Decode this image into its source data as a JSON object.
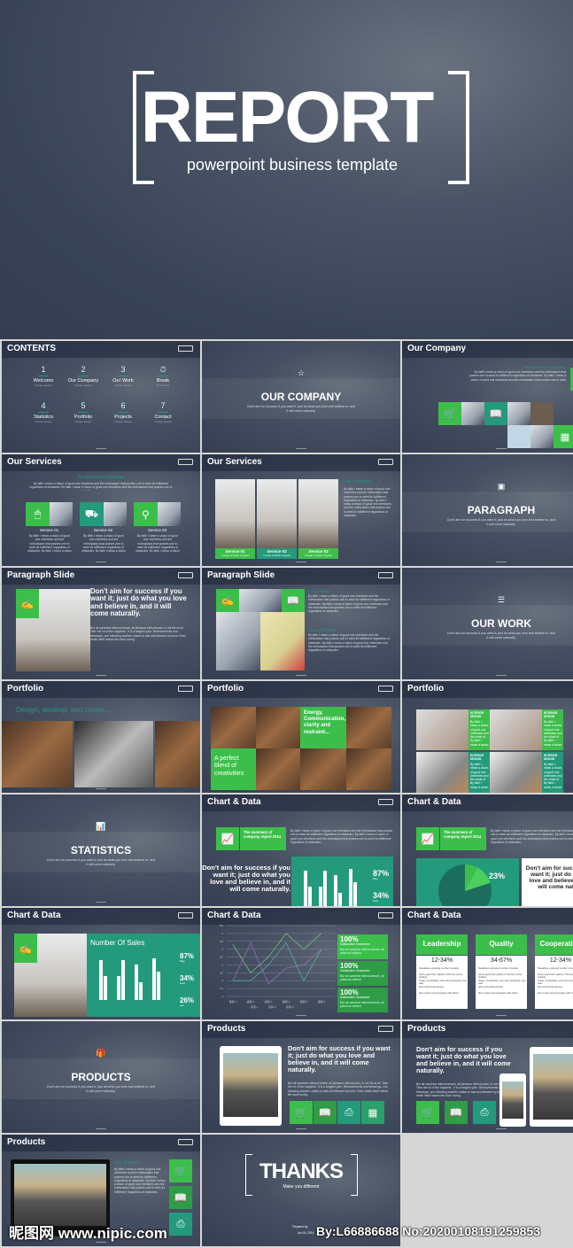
{
  "hero": {
    "title": "REPORT",
    "subtitle": "powerpoint business template"
  },
  "colors": {
    "green": "#3cbf4a",
    "green_dark": "#2e9d45",
    "teal": "#239a7c",
    "bg": "#3a4457"
  },
  "lorem": "By faith I mean a vision of good one cherishes and the enthusiasm that pushes one to seek its fulfillment regardless of obstacles. By faith I mean a vision of good one cherishes and the enthusiasm that pushes one to seek its fulfillment regardless of obstacles.",
  "lorem2": "But all sunshine without shade, all pleasure without pain, is not life at all. Take the lot of the happiest - it is a tangled yarn. Bereavements and blessings, one following another, make us sad and blessed by turns. Even death itself makes life more loving.",
  "slides": [
    {
      "type": "contents",
      "title": "CONTENTS",
      "items": [
        {
          "num": "1",
          "label": "Welcome",
          "sub": "Unique design"
        },
        {
          "num": "2",
          "label": "Our Company",
          "sub": "Unique design"
        },
        {
          "num": "3",
          "label": "Our Work",
          "sub": "Unique design"
        },
        {
          "num": "⏱",
          "label": "Break",
          "sub": "10 minutes"
        },
        {
          "num": "4",
          "label": "Statistics",
          "sub": "Unique design"
        },
        {
          "num": "5",
          "label": "Portfolio",
          "sub": "Unique design"
        },
        {
          "num": "6",
          "label": "Projects",
          "sub": "Unique design"
        },
        {
          "num": "7",
          "label": "Contact",
          "sub": "Unique design"
        }
      ]
    },
    {
      "type": "section",
      "icon": "star-icon",
      "glyph": "☆",
      "heading": "OUR COMPANY",
      "text": "Don't aim for success if you want it; just do what you love and believe in, and it will come naturally."
    },
    {
      "type": "company",
      "title": "Our Company",
      "heading": "An Awesome Company"
    },
    {
      "type": "services",
      "title": "Our Services",
      "heading": "An Awesome Company",
      "services": [
        {
          "label": "Service 01",
          "icon": "mouse-icon",
          "glyph": "🖱"
        },
        {
          "label": "Service 02",
          "icon": "truck-icon",
          "glyph": "⛟"
        },
        {
          "label": "Service 03",
          "icon": "usb-icon",
          "glyph": "⚲"
        }
      ]
    },
    {
      "type": "services2",
      "title": "Our Services",
      "heading": "Our Company",
      "services": [
        {
          "label": "Service 01",
          "sub": "I mean a vision of good"
        },
        {
          "label": "Service 02",
          "sub": "I mean a vision of good"
        },
        {
          "label": "Service 03",
          "sub": "I mean a vision of good"
        }
      ]
    },
    {
      "type": "section",
      "icon": "image-icon",
      "glyph": "▣",
      "heading": "PARAGRAPH",
      "text": "Don't aim for success if you want it; just do what you love and believe in, and it will come naturally."
    },
    {
      "type": "paragraph1",
      "title": "Paragraph Slide",
      "quote": "Don't aim for success if you want it; just do what you love and believe in, and it will come naturally."
    },
    {
      "type": "paragraph2",
      "title": "Paragraph Slide",
      "ch1": "First chapter",
      "ch2": "Second chapter"
    },
    {
      "type": "section",
      "icon": "list-icon",
      "glyph": "☰",
      "heading": "OUR WORK",
      "text": "Don't aim for success if you want it; just do what you love and believe in, and it will come naturally."
    },
    {
      "type": "portfolio1",
      "title": "Portfolio",
      "tagline": "Design, develop, and create...."
    },
    {
      "type": "portfolio2",
      "title": "Portfolio",
      "box1": "Energy, Communication, clarity and restraint...",
      "box2": "A perfect blend of creativities"
    },
    {
      "type": "portfolio3",
      "title": "Portfolio",
      "label": "INTERIOR DESIGN",
      "text": "By faith I mean a vision of good one cherishes and the chain of By faith I mean a vision of"
    },
    {
      "type": "section",
      "icon": "bar-chart-icon",
      "glyph": "📊",
      "heading": "STATISTICS",
      "text": "Don't aim for success if you want it; just do what you love and believe in, and it will come naturally."
    },
    {
      "type": "bar",
      "title": "Chart & Data",
      "summary": "The summary of company report 2014",
      "quote": "Don't aim for success if you want it; just do what you love and believe in, and it will come naturally.",
      "bars": [
        [
          5,
          3
        ],
        [
          3,
          5
        ],
        [
          4.5,
          2.2
        ],
        [
          5.2,
          3.6
        ]
      ],
      "stats": [
        {
          "value": "87%",
          "label": "May"
        },
        {
          "value": "34%",
          "label": "Feel"
        }
      ]
    },
    {
      "type": "pie",
      "title": "Chart & Data",
      "summary": "The summary of company report 2014",
      "quote": "Don't aim for success if you want it; just do what you love and believe in, and it will come naturally.",
      "pct": "23%"
    },
    {
      "type": "sales",
      "title": "Chart & Data",
      "heading": "Number Of Sales",
      "bars": [
        [
          5,
          3
        ],
        [
          3,
          5
        ],
        [
          4.5,
          2.2
        ],
        [
          5.2,
          3.6
        ]
      ],
      "stats": [
        {
          "value": "87%",
          "label": "May"
        },
        {
          "value": "34%",
          "label": "Feel"
        },
        {
          "value": "26%",
          "label": "Jun"
        }
      ]
    },
    {
      "type": "line",
      "title": "Chart & Data",
      "cats": [
        "类别 1",
        "类别 2",
        "类别 3",
        "类别 4",
        "类别 5",
        "类别 6"
      ],
      "series": [
        [
          4.3,
          2.5,
          3.5,
          5,
          4,
          5
        ],
        [
          2,
          4.4,
          1.8,
          2.8,
          3,
          4
        ],
        [
          2,
          2,
          3,
          4.4,
          2,
          4
        ]
      ],
      "ticks": [
        "5.5",
        "5",
        "4.5",
        "4",
        "3.5",
        "3",
        "2.5",
        "2",
        "1.5",
        "1"
      ],
      "legend": [
        "系列 1",
        "系列 2",
        "系列 3"
      ],
      "boxes": [
        {
          "value": "100%",
          "label": "Satisfaction Guarantee",
          "text": "But all sunshine without shade, all pleasure without"
        },
        {
          "value": "100%",
          "label": "Satisfaction Guarantee",
          "text": "But all sunshine without shade, all pleasure without"
        },
        {
          "value": "100%",
          "label": "Satisfaction Guarantee",
          "text": "But all sunshine without shade, all pleasure without"
        }
      ]
    },
    {
      "type": "tiers",
      "title": "Chart & Data",
      "tiers": [
        {
          "name": "Leadership",
          "range": "12-34%"
        },
        {
          "name": "Quality",
          "range": "34-67%"
        },
        {
          "name": "Cooperation",
          "range": "12-34%"
        }
      ],
      "bullets": [
        "Nowadays a growing number of people",
        "Some spend the majority of the time online chatting",
        "cheap, comfortable, and most importantly, very safe",
        "lack of physical exercise",
        "face to face communication with others"
      ]
    },
    {
      "type": "section",
      "icon": "gift-icon",
      "glyph": "🎁",
      "heading": "PRODUCTS",
      "text": "Don't aim for success if you want it; just do what you love and believe in, and it will come naturally."
    },
    {
      "type": "product1",
      "title": "Products",
      "quote": "Don't aim for success if you want it; just do what you love and believe in, and it will come naturally."
    },
    {
      "type": "product2",
      "title": "Products",
      "quote": "Don't aim for success if you want it; just do what you love and believe in, and it will come naturally."
    },
    {
      "type": "product3",
      "title": "Products",
      "heading": "Our Product"
    },
    {
      "type": "thanks",
      "heading": "THANKS",
      "sub": "Make you different",
      "prepared": "Prepared by:",
      "date": "Jun 18, 2014"
    }
  ],
  "watermark": {
    "site": "昵图网 www.nipic.com",
    "id": "By:L66886688 No:20200108191259853"
  }
}
